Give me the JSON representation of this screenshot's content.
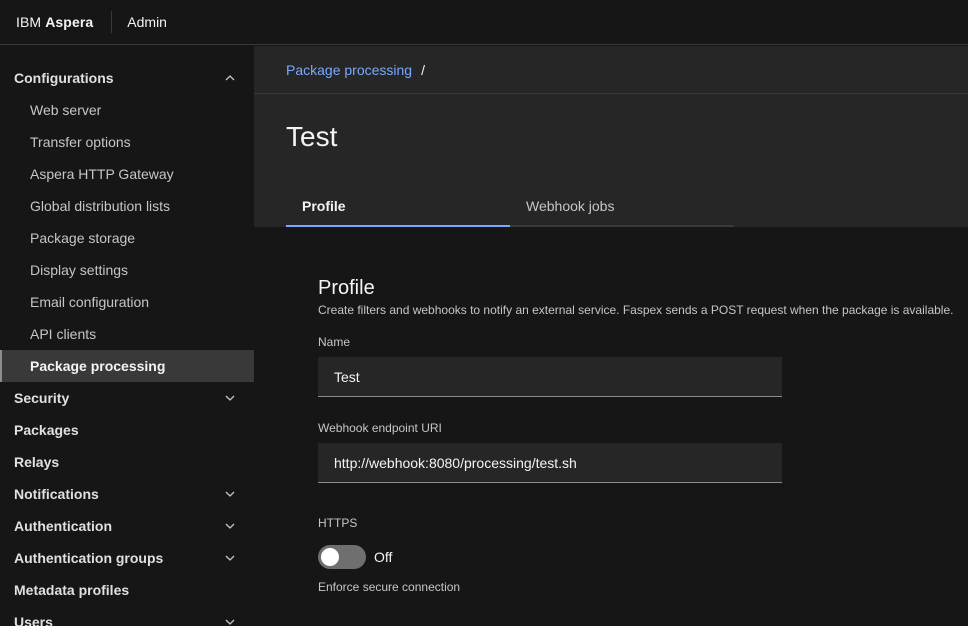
{
  "header": {
    "brand_prefix": "IBM",
    "brand_name": "Aspera",
    "section": "Admin"
  },
  "sidebar": {
    "configurations": {
      "label": "Configurations",
      "items": [
        "Web server",
        "Transfer options",
        "Aspera HTTP Gateway",
        "Global distribution lists",
        "Package storage",
        "Display settings",
        "Email configuration",
        "API clients",
        "Package processing"
      ],
      "active": "Package processing"
    },
    "groups": [
      {
        "label": "Security"
      },
      {
        "label": "Packages"
      },
      {
        "label": "Relays"
      },
      {
        "label": "Notifications"
      },
      {
        "label": "Authentication"
      },
      {
        "label": "Authentication groups"
      },
      {
        "label": "Metadata profiles"
      },
      {
        "label": "Users"
      }
    ]
  },
  "breadcrumb": {
    "link": "Package processing",
    "separator": "/"
  },
  "page": {
    "title": "Test"
  },
  "tabs": [
    {
      "label": "Profile"
    },
    {
      "label": "Webhook jobs"
    }
  ],
  "profile": {
    "title": "Profile",
    "description": "Create filters and webhooks to notify an external service. Faspex sends a POST request when the package is available.",
    "name_label": "Name",
    "name_value": "Test",
    "uri_label": "Webhook endpoint URI",
    "uri_value": "http://webhook:8080/processing/test.sh",
    "https_label": "HTTPS",
    "https_state": "Off",
    "https_helper": "Enforce secure connection"
  },
  "colors": {
    "link": "#78a9ff",
    "active_tab_underline": "#78a9ff",
    "surface": "#262626",
    "background": "#161616"
  }
}
